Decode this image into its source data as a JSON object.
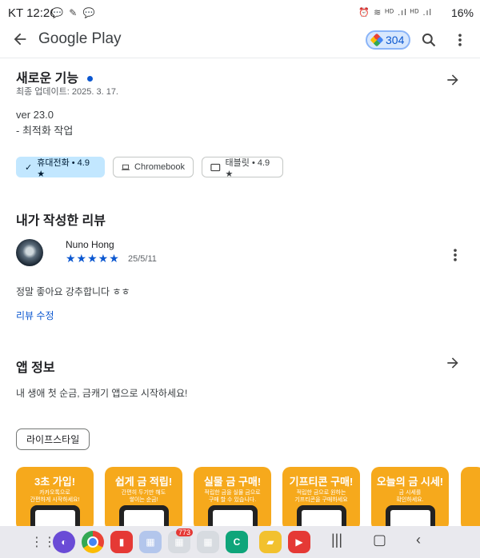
{
  "status": {
    "time": "KT 12:26",
    "battery": "16%",
    "left_icons": "💬 ✎ 💬",
    "right_icons": "⏰ ≋ ᴴᴰ .ıl ᴴᴰ .ıl"
  },
  "appbar": {
    "brand": "Google Play",
    "points": "304"
  },
  "whats_new": {
    "title": "새로운 기능",
    "updated": "최종 업데이트: 2025. 3. 17.",
    "version": "ver 23.0",
    "note": "- 최적화 작업"
  },
  "devices": [
    {
      "label": "휴대전화 • 4.9 ★",
      "selected": true,
      "icon": "check-icon"
    },
    {
      "label": "Chromebook",
      "selected": false,
      "icon": "laptop-icon"
    },
    {
      "label": "태블릿 • 4.9 ★",
      "selected": false,
      "icon": "tablet-icon"
    }
  ],
  "my_review": {
    "heading": "내가 작성한 리뷰",
    "author": "Nuno Hong",
    "stars": "★★★★★",
    "date": "25/5/11",
    "text": "정말 좋아요 강추합니다 ㅎㅎ",
    "edit_label": "리뷰 수정"
  },
  "app_info": {
    "heading": "앱 정보",
    "description": "내 생애 첫 순금, 금캐기 앱으로 시작하세요!",
    "category": "라이프스타일"
  },
  "screenshots": [
    {
      "title": "3초 가입!",
      "desc": "카카오톡으로\n간편하게 시작하세요!"
    },
    {
      "title": "쉽게 금 적립!",
      "desc": "간편히 두기만 해도\n쌓이는 순금!"
    },
    {
      "title": "실물 금 구매!",
      "desc": "적립한 금을 실물 금으로\n구매 할 수 있습니다."
    },
    {
      "title": "기프티콘 구매!",
      "desc": "적립한 금으로 원하는\n기프티콘을 구매하세요"
    },
    {
      "title": "오늘의 금 시세!",
      "desc": "금 시세를\n확인하세요."
    }
  ],
  "dock": {
    "badge": "773"
  }
}
